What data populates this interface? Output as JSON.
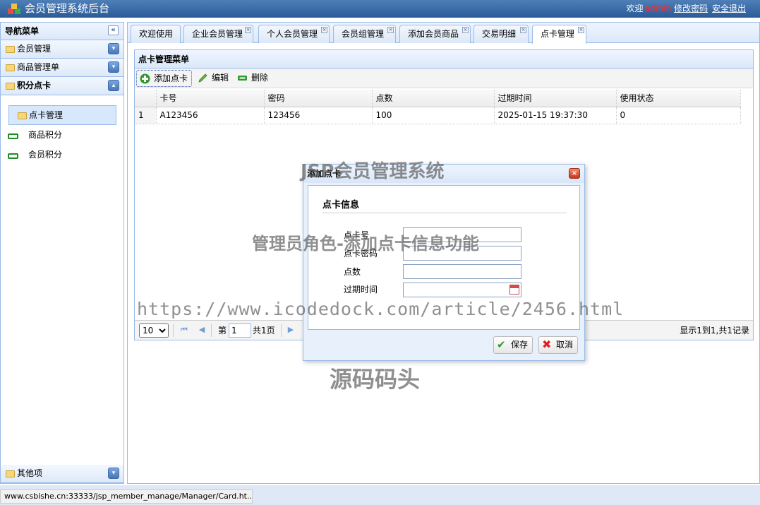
{
  "header": {
    "title": "会员管理系统后台",
    "welcome": "欢迎",
    "username": "admin",
    "change_password": "修改密码",
    "logout": "安全退出"
  },
  "sidebar": {
    "title": "导航菜单",
    "groups": [
      {
        "label": "会员管理"
      },
      {
        "label": "商品管理单"
      },
      {
        "label": "积分点卡"
      }
    ],
    "items": [
      {
        "label": "点卡管理",
        "selected": true
      },
      {
        "label": "商品积分"
      },
      {
        "label": "会员积分"
      }
    ],
    "other": "其他项"
  },
  "tabs": [
    {
      "label": "欢迎使用"
    },
    {
      "label": "企业会员管理"
    },
    {
      "label": "个人会员管理"
    },
    {
      "label": "会员组管理"
    },
    {
      "label": "添加会员商品"
    },
    {
      "label": "交易明细"
    },
    {
      "label": "点卡管理",
      "active": true
    }
  ],
  "grid": {
    "title": "点卡管理菜单",
    "toolbar": {
      "add": "添加点卡",
      "edit": "编辑",
      "delete": "删除"
    },
    "columns": [
      "卡号",
      "密码",
      "点数",
      "过期时间",
      "使用状态"
    ],
    "rows": [
      {
        "num": "1",
        "cells": [
          "A123456",
          "123456",
          "100",
          "2025-01-15 19:37:30",
          "0"
        ]
      }
    ],
    "pager": {
      "page_size": "10",
      "page_prefix": "第",
      "page": "1",
      "page_suffix": "共1页",
      "info": "显示1到1,共1记录"
    }
  },
  "dialog": {
    "title": "添加点卡",
    "section": "点卡信息",
    "fields": [
      {
        "label": "点卡号",
        "value": ""
      },
      {
        "label": "点卡密码",
        "value": ""
      },
      {
        "label": "点数",
        "value": ""
      },
      {
        "label": "过期时间",
        "value": ""
      }
    ],
    "save": "保存",
    "cancel": "取消"
  },
  "watermarks": {
    "system": "JSP会员管理系统",
    "feature": "管理员角色-添加点卡信息功能",
    "url": "https://www.icodedock.com/article/2456.html",
    "brand": "源码码头"
  },
  "statusbar": {
    "url": "www.csbishe.cn:33333/jsp_member_manage/Manager/Card.ht..."
  },
  "colors": {
    "accent": "#2a5b98",
    "border": "#99bbe8",
    "username": "#ff2a2a"
  },
  "icons": {
    "logo": "cubes-logo-icon",
    "add": "plus-circle-icon",
    "edit": "pencil-icon",
    "delete": "minus-icon",
    "save": "check-icon",
    "cancel": "x-icon"
  }
}
